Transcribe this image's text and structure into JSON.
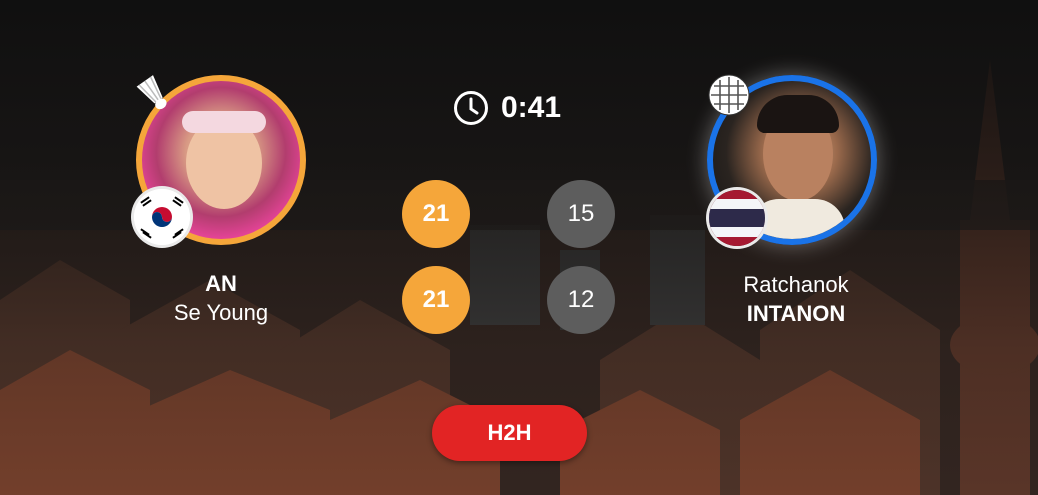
{
  "match": {
    "elapsed": "0:41"
  },
  "player_left": {
    "surname": "AN",
    "given_name": "Se Young",
    "country_flag": "south-korea-flag-icon",
    "accent_color": "#f5a63a",
    "serving_icon": "shuttlecock-icon"
  },
  "player_right": {
    "given_name": "Ratchanok",
    "surname": "INTANON",
    "country_flag": "thailand-flag-icon",
    "accent_color": "#1a73e8",
    "serving_icon": "racket-icon"
  },
  "games": [
    {
      "left": "21",
      "right": "15"
    },
    {
      "left": "21",
      "right": "12"
    }
  ],
  "actions": {
    "h2h_label": "H2H",
    "h2h_color": "#e22424"
  }
}
